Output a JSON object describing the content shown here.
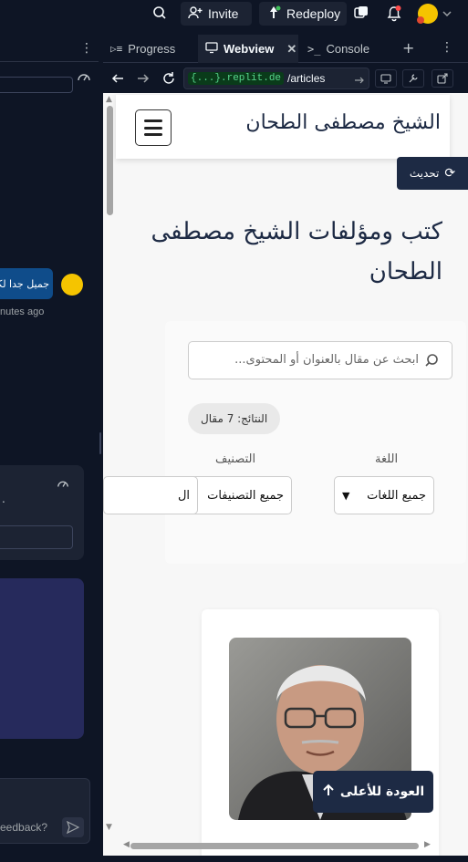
{
  "topbar": {
    "invite_label": "Invite",
    "redeploy_label": "Redeploy"
  },
  "left_panel": {
    "chat_bubble_text": "جميل جدا لكن",
    "timestamp_text": "nutes ago",
    "feedback_placeholder": "eedback?"
  },
  "tabs": [
    {
      "label": "Progress"
    },
    {
      "label": "Webview"
    },
    {
      "label": "Console"
    }
  ],
  "urlbar": {
    "domain_pill": "{...}.replit.de",
    "path": "/articles"
  },
  "site": {
    "title": "الشيخ مصطفى الطحان",
    "refresh_label": "تحديث",
    "page_heading": "كتب ومؤلفات الشيخ مصطفى الطحان",
    "search_placeholder": "ابحث عن مقال بالعنوان أو المحتوى...",
    "results_label": "النتائج: 7 مقال",
    "language_label": "اللغة",
    "language_value": "جميع اللغات",
    "category_label": "التصنيف",
    "category_value": "جميع التصنيفات",
    "third_select_value": "ال",
    "back_to_top_label": "العودة للأعلى"
  },
  "colors": {
    "ide_bg": "#0e1525",
    "navy": "#1d2a44",
    "accent_yellow": "#f5c400"
  }
}
